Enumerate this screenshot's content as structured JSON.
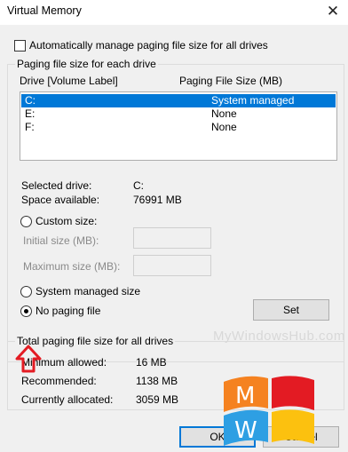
{
  "window": {
    "title": "Virtual Memory",
    "close_glyph": "✕"
  },
  "auto_manage": {
    "label": "Automatically manage paging file size for all drives",
    "checked": false
  },
  "paging_group": {
    "title": "Paging file size for each drive",
    "col_drive": "Drive  [Volume Label]",
    "col_size": "Paging File Size (MB)",
    "drives": [
      {
        "drive": "C:",
        "size": "System managed",
        "selected": true
      },
      {
        "drive": "E:",
        "size": "None",
        "selected": false
      },
      {
        "drive": "F:",
        "size": "None",
        "selected": false
      }
    ],
    "selected_drive_label": "Selected drive:",
    "selected_drive_value": "C:",
    "space_available_label": "Space available:",
    "space_available_value": "76991 MB",
    "custom_size": "Custom size:",
    "initial_size": "Initial size (MB):",
    "maximum_size": "Maximum size (MB):",
    "system_managed": "System managed size",
    "no_paging": "No paging file",
    "set_button": "Set"
  },
  "totals_group": {
    "title": "Total paging file size for all drives",
    "min_label": "Minimum allowed:",
    "min_value": "16 MB",
    "rec_label": "Recommended:",
    "rec_value": "1138 MB",
    "cur_label": "Currently allocated:",
    "cur_value": "3059 MB"
  },
  "buttons": {
    "ok": "OK",
    "cancel": "Cancel"
  },
  "watermark": {
    "text": "MyWindowsHub.com",
    "logo_letters": [
      "M",
      "W"
    ]
  },
  "colors": {
    "selection": "#0078d7",
    "accent_red": "#e31b23"
  }
}
